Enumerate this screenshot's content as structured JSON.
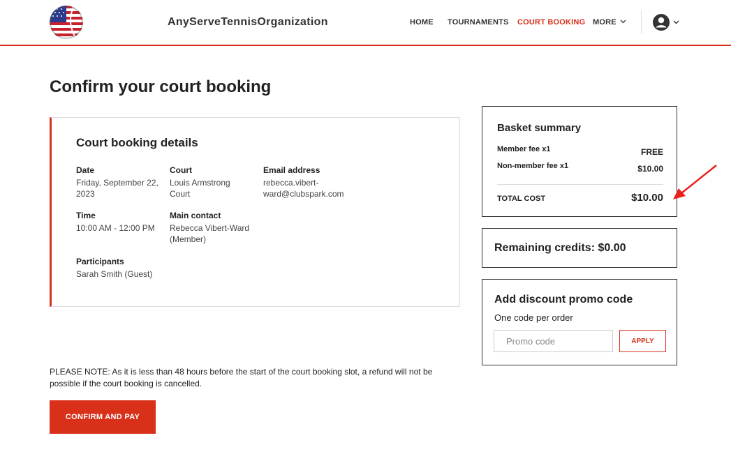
{
  "header": {
    "org_name": "AnyServeTennisOrganization",
    "nav": [
      "HOME",
      "TOURNAMENTS",
      "COURT BOOKING",
      "MORE"
    ],
    "active_nav": "COURT BOOKING"
  },
  "page": {
    "title": "Confirm your court booking"
  },
  "details": {
    "title": "Court booking details",
    "date_label": "Date",
    "date_value": "Friday, September 22, 2023",
    "court_label": "Court",
    "court_value": "Louis Armstrong Court",
    "email_label": "Email address",
    "email_value": "rebecca.vibert-ward@clubspark.com",
    "time_label": "Time",
    "time_value": "10:00 AM - 12:00 PM",
    "contact_label": "Main contact",
    "contact_value": "Rebecca Vibert-Ward (Member)",
    "participants_label": "Participants",
    "participants_value": "Sarah Smith (Guest)"
  },
  "note": "PLEASE NOTE: As it is less than 48 hours before the start of the court booking slot, a refund will not be possible if the court booking is cancelled.",
  "confirm_label": "CONFIRM AND PAY",
  "basket": {
    "title": "Basket summary",
    "rows": [
      {
        "label": "Member fee x1",
        "amount": "FREE"
      },
      {
        "label": "Non-member fee x1",
        "amount": "$10.00"
      }
    ],
    "total_label": "TOTAL COST",
    "total_value": "$10.00"
  },
  "credits": {
    "text": "Remaining credits: $0.00"
  },
  "promo": {
    "title": "Add discount promo code",
    "subtitle": "One code per order",
    "placeholder": "Promo code",
    "apply_label": "APPLY"
  },
  "colors": {
    "accent": "#d9301a",
    "annotation_arrow": "#e8211d"
  },
  "icons": {
    "user": "user-circle-icon",
    "more": "chevron-down-icon",
    "logo": "tennis-ball-flag-logo"
  }
}
